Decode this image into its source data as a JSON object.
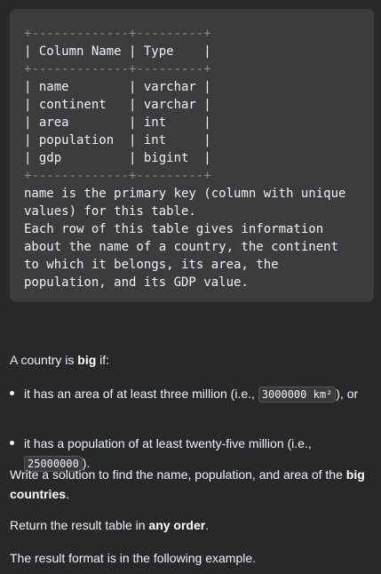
{
  "schema_block": {
    "lines": [
      "+-------------+---------+",
      "| Column Name | Type    |",
      "+-------------+---------+",
      "| name        | varchar |",
      "| continent   | varchar |",
      "| area        | int     |",
      "| population  | int     |",
      "| gdp         | bigint  |",
      "+-------------+---------+",
      "name is the primary key (column with unique",
      "values) for this table.",
      "Each row of this table gives information",
      "about the name of a country, the continent",
      "to which it belongs, its area, the",
      "population, and its GDP value."
    ]
  },
  "intro": {
    "before": "A country is ",
    "bold": "big",
    "after": " if:"
  },
  "bullets": [
    {
      "before": "it has an area of at least three million (i.e., ",
      "code": "3000000 km²",
      "after": "), or"
    },
    {
      "before": "it has a population of at least twenty-five million (i.e., ",
      "code": "25000000",
      "after": ")."
    }
  ],
  "write_solution": {
    "before": "Write a solution to find the name, population, and area of the ",
    "bold": "big countries",
    "after": "."
  },
  "return_table": {
    "before": "Return the result table in ",
    "bold": "any order",
    "after": "."
  },
  "result_format": "The result format is in the following example."
}
